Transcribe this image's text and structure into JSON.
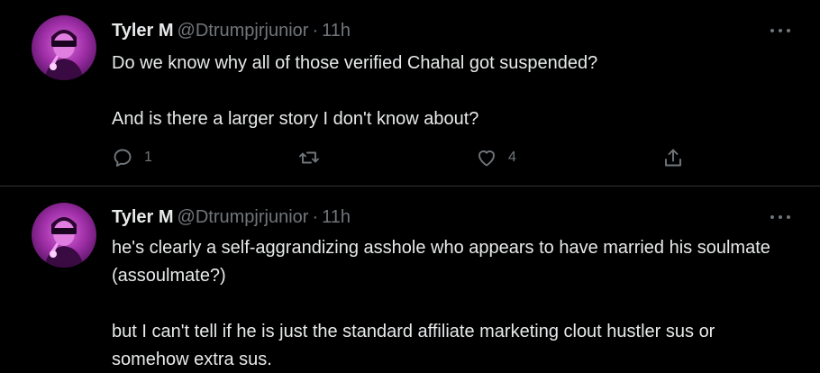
{
  "tweets": [
    {
      "author": {
        "name": "Tyler M",
        "handle": "@Dtrumpjrjunior",
        "separator": "·",
        "time": "11h"
      },
      "paragraphs": [
        "Do we know why all of those verified Chahal got suspended?",
        "And is there a larger story I don't know about?"
      ],
      "actions": {
        "reply_count": "1",
        "retweet_count": "",
        "like_count": "4"
      },
      "icons": [
        "more-icon",
        "reply-icon",
        "retweet-icon",
        "like-icon",
        "share-icon"
      ]
    },
    {
      "author": {
        "name": "Tyler M",
        "handle": "@Dtrumpjrjunior",
        "separator": "·",
        "time": "11h"
      },
      "paragraphs": [
        "he's clearly a self-aggrandizing  asshole who appears to have married his soulmate (assoulmate?)",
        "but I can't tell if he is just the standard affiliate marketing clout hustler sus or somehow extra sus."
      ],
      "icons": [
        "more-icon"
      ]
    }
  ],
  "colors": {
    "background": "#000000",
    "primary_text": "#e7e9ea",
    "secondary_text": "#71767b",
    "divider": "#2f3336",
    "avatar_accent": "#b23bb8"
  }
}
